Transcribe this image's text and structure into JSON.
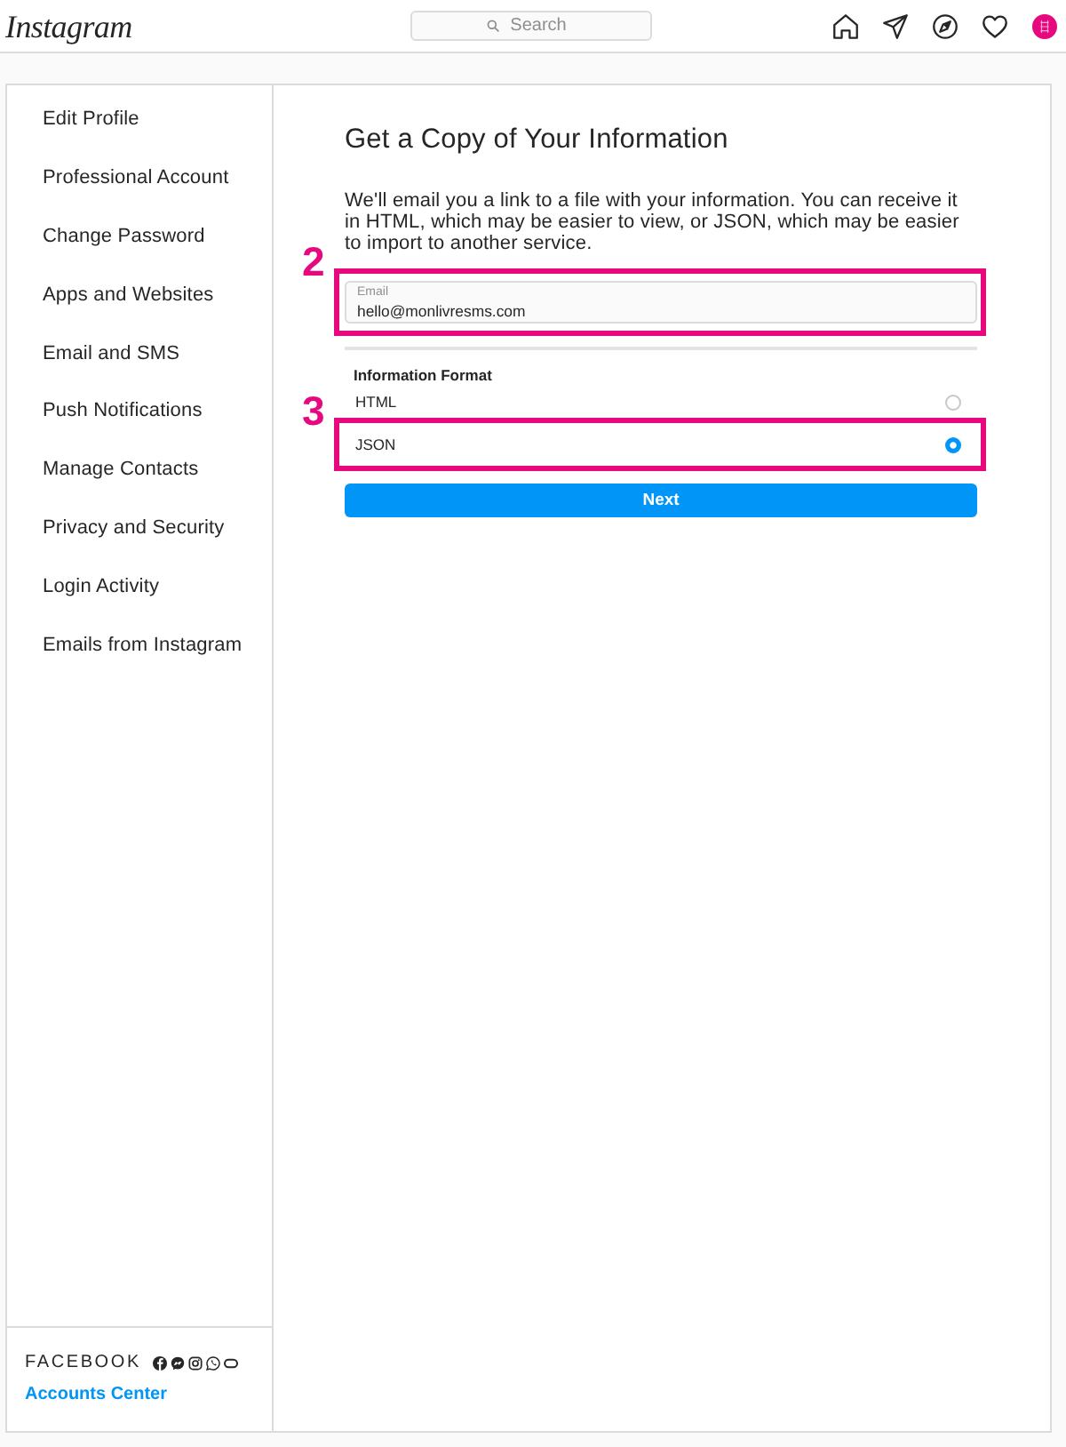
{
  "top_bar": {
    "logo": "Instagram",
    "search": {
      "placeholder": "Search"
    }
  },
  "sidebar": {
    "items": [
      {
        "label": "Edit Profile",
        "selected": false
      },
      {
        "label": "Professional Account",
        "selected": false
      },
      {
        "label": "Change Password",
        "selected": false
      },
      {
        "label": "Apps and Websites",
        "selected": false
      },
      {
        "label": "Email and SMS",
        "selected": false
      },
      {
        "label": "Push Notifications",
        "selected": false
      },
      {
        "label": "Manage Contacts",
        "selected": false
      },
      {
        "label": "Privacy and Security",
        "selected": false
      },
      {
        "label": "Login Activity",
        "selected": false
      },
      {
        "label": "Emails from Instagram",
        "selected": false
      }
    ],
    "footer": {
      "brand": "FACEBOOK",
      "link": "Accounts Center"
    }
  },
  "main": {
    "title": "Get a Copy of Your Information",
    "description": "We'll email you a link to a file with your information. You can receive it in HTML, which may be easier to view, or JSON, which may be easier to import to another service.",
    "email_field": {
      "label": "Email",
      "value": "hello@monlivresms.com",
      "callout": "2"
    },
    "format": {
      "label": "Information Format",
      "options": [
        {
          "label": "HTML",
          "selected": false
        },
        {
          "label": "JSON",
          "selected": true,
          "callout": "3"
        }
      ]
    },
    "next_button": "Next"
  }
}
